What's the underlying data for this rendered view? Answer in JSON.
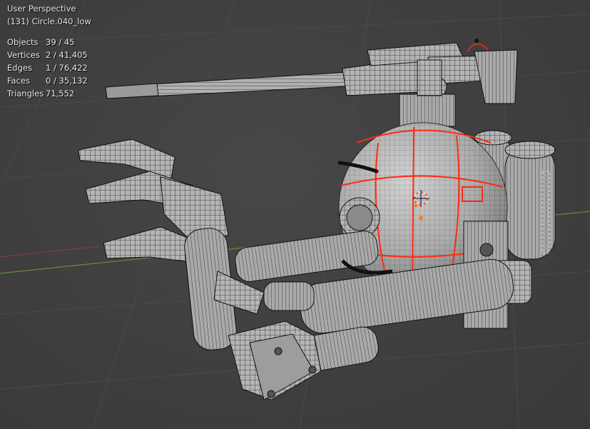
{
  "viewport": {
    "view_name": "User Perspective",
    "active_object": "(131) Circle.040_low"
  },
  "stats": [
    {
      "label": "Objects",
      "value": "39 / 45"
    },
    {
      "label": "Vertices",
      "value": "2 / 41,405"
    },
    {
      "label": "Edges",
      "value": "1 / 76,422"
    },
    {
      "label": "Faces",
      "value": "0 / 35,132"
    },
    {
      "label": "Triangles",
      "value": "71,552"
    }
  ],
  "colors": {
    "background": "#3d3d3d",
    "grid_line": "#4a4a4a",
    "x_axis": "#8a3f3f",
    "y_axis": "#5f8a35",
    "mesh_fill": "#bdbdbd",
    "mesh_shade": "#8c8c8c",
    "wire": "#1e1e1e",
    "selection": "#ff2a12"
  }
}
